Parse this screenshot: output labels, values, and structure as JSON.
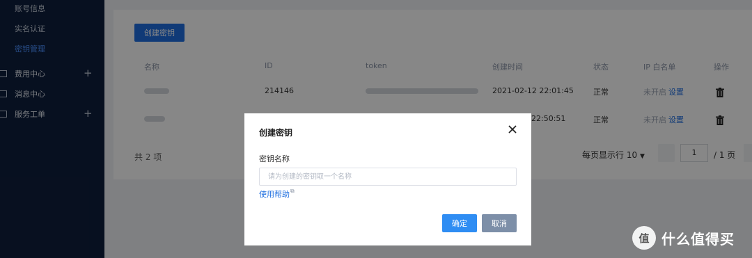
{
  "sidebar": {
    "sub_items": [
      "账号信息",
      "实名认证",
      "密钥管理"
    ],
    "groups": [
      {
        "label": "费用中心",
        "expandable": true
      },
      {
        "label": "消息中心",
        "expandable": false
      },
      {
        "label": "服务工单",
        "expandable": true
      }
    ]
  },
  "main": {
    "create_button": "创建密钥",
    "columns": [
      "名称",
      "ID",
      "token",
      "创建时间",
      "状态",
      "IP 白名单",
      "操作"
    ],
    "rows": [
      {
        "id": "214146",
        "created": "2021-02-12 22:01:45",
        "status": "正常",
        "whitelist": "未开启",
        "whitelist_link": "设置"
      },
      {
        "id": "",
        "created": "22:50:51",
        "status": "正常",
        "whitelist": "未开启",
        "whitelist_link": "设置"
      }
    ],
    "pagination": {
      "total": "共 2 项",
      "per_page_label": "每页显示行",
      "per_page_value": "10",
      "current_page": "1",
      "total_pages": "/ 1 页"
    }
  },
  "modal": {
    "title": "创建密钥",
    "field_label": "密钥名称",
    "placeholder": "请为创建的密钥取一个名称",
    "help_link": "使用帮助",
    "confirm": "确定",
    "cancel": "取消"
  },
  "watermark": {
    "logo_text": "值",
    "text": "什么值得买"
  },
  "colors": {
    "sidebar_bg": "#0f1f3d",
    "primary": "#1f6fe0",
    "confirm": "#2f8df3",
    "cancel": "#7d8fa8"
  }
}
